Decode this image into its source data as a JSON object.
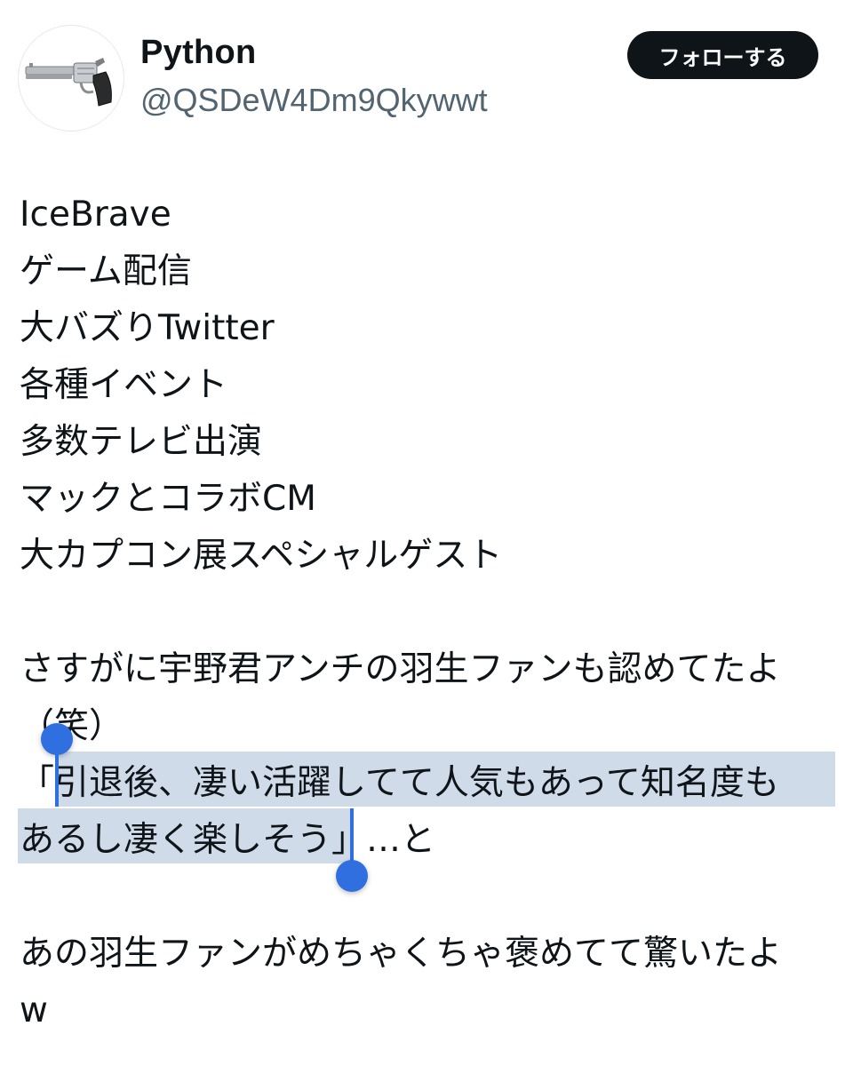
{
  "profile": {
    "display_name": "Python",
    "handle": "@QSDeW4Dm9Qkywwt",
    "avatar_icon": "revolver-icon"
  },
  "follow_button": {
    "label": "フォローする"
  },
  "tweet": {
    "lines": [
      "IceBrave",
      "ゲーム配信",
      "大バズりTwitter",
      "各種イベント",
      "多数テレビ出演",
      "マックとコラボCM",
      "大カプコン展スペシャルゲスト",
      "",
      "さすがに宇野君アンチの羽生ファンも認めてたよ",
      "（笑）"
    ],
    "quote_open": "「",
    "selected_line_1": "引退後、凄い活躍してて人気もあって知名度も",
    "selected_line_2": "あるし凄く楽しそう",
    "quote_close_tail": "」…と",
    "after_lines": [
      "",
      "あの羽生ファンがめちゃくちゃ褒めてて驚いたよ",
      "w"
    ]
  },
  "selection_color": "#cfdbe8",
  "handle_color": "#2f6fe0"
}
